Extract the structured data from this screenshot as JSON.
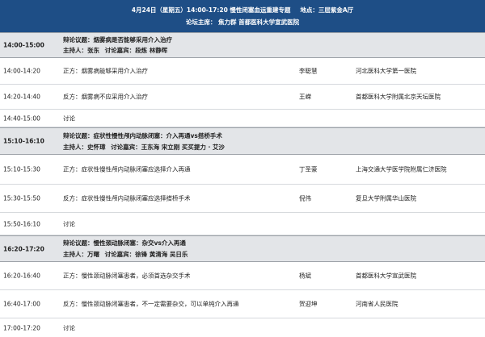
{
  "header": {
    "line1": {
      "date": "4月24日（星期五）14:00-17:20 慢性闭塞血运重建专题",
      "location": "地点：三层紫金A厅"
    },
    "line2": "论坛主席：  焦力群 首都医科大学宣武医院"
  },
  "sections": [
    {
      "time": "14:00-15:00",
      "topic": "辩论议题：烟雾病是否能够采用介入治疗",
      "chair_label": "主持人：张东",
      "guest_label": "讨论嘉宾：段炼 林静晖",
      "items": [
        {
          "time": "14:00-14:20",
          "topic": "正方：烟雾病能够采用介入治疗",
          "speaker": "李聪慧",
          "inst": "河北医科大学第一医院"
        },
        {
          "time": "14:20-14:40",
          "topic": "反方：烟雾病不应采用介入治疗",
          "speaker": "王嵘",
          "inst": "首都医科大学附属北京天坛医院"
        },
        {
          "time": "14:40-15:00",
          "topic": "讨论",
          "speaker": "",
          "inst": ""
        }
      ]
    },
    {
      "time": "15:10-16:10",
      "topic": "辩论议题：症状性慢性颅内动脉闭塞：介入再通vs搭桥手术",
      "chair_label": "主持人：史怀璋",
      "guest_label": "讨论嘉宾：王东海 宋立刚 买买提力 · 艾沙",
      "items": [
        {
          "time": "15:10-15:30",
          "topic": "正方：症状性慢性颅内动脉闭塞应选择介入再通",
          "speaker": "丁圣豪",
          "inst": "上海交通大学医学院附属仁济医院"
        },
        {
          "time": "15:30-15:50",
          "topic": "反方：症状性慢性颅内动脉闭塞应选择搭桥手术",
          "speaker": "倪伟",
          "inst": "复旦大学附属华山医院"
        },
        {
          "time": "15:50-16:10",
          "topic": "讨论",
          "speaker": "",
          "inst": ""
        }
      ]
    },
    {
      "time": "16:20-17:20",
      "topic": "辩论议题：慢性颈动脉闭塞：杂交vs介入再通",
      "chair_label": "主持人：万曙",
      "guest_label": "讨论嘉宾：徐锋 黄清海 吴日乐",
      "items": [
        {
          "time": "16:20-16:40",
          "topic": "正方：慢性颈动脉闭塞患者，必须首选杂交手术",
          "speaker": "杨斌",
          "inst": "首都医科大学宣武医院"
        },
        {
          "time": "16:40-17:00",
          "topic": "反方：慢性颈动脉闭塞患者，不一定需要杂交，可以单纯介入再通",
          "speaker": "贺迎坤",
          "inst": "河南省人民医院"
        },
        {
          "time": "17:00-17:20",
          "topic": "讨论",
          "speaker": "",
          "inst": ""
        }
      ]
    }
  ]
}
